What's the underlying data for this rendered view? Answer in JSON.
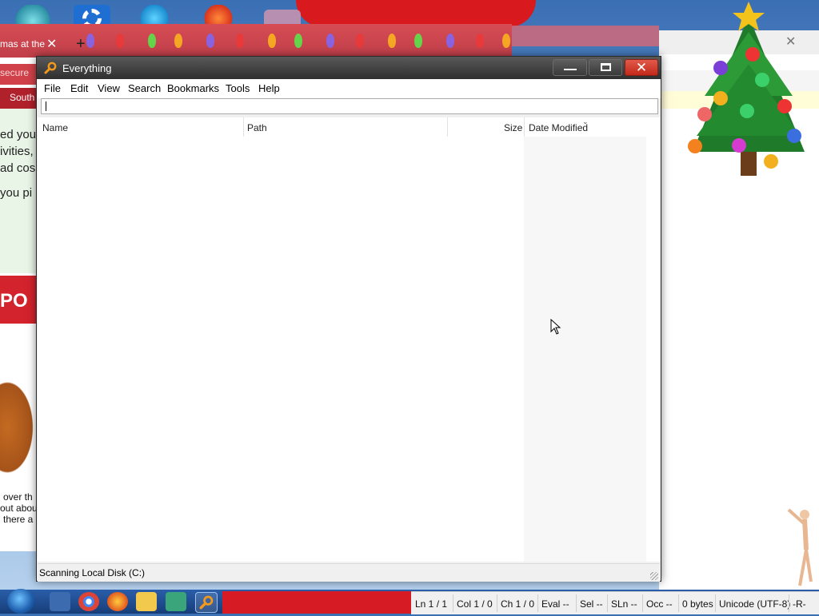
{
  "window": {
    "title": "Everything",
    "menu": [
      "File",
      "Edit",
      "View",
      "Search",
      "Bookmarks",
      "Tools",
      "Help"
    ],
    "search": {
      "value": "",
      "placeholder": ""
    },
    "columns": [
      "Name",
      "Path",
      "Size",
      "Date Modified"
    ],
    "status": "Scanning Local Disk (C:)"
  },
  "background_browser": {
    "tab_title": "mas at the",
    "address_fragment": "secure",
    "nav_fragment": "South",
    "content_lines": [
      "ed your",
      "ivities,",
      "ad cos",
      "you pi"
    ],
    "band_text": "PO",
    "lower_lines": [
      "over th",
      "out abou",
      "there a"
    ]
  },
  "editor_status": {
    "items": [
      "Ln 1 / 1",
      "Col 1 / 0",
      "Ch 1 / 0",
      "Eval --",
      "Sel --",
      "SLn --",
      "Occ --",
      "0 bytes",
      "Unicode (UTF-8)",
      "-R-"
    ]
  },
  "colors": {
    "titlebar": "#3a3a3a",
    "close_red": "#d2392a",
    "taskbar_blue": "#1f4d92",
    "browser_red": "#c8404a"
  },
  "icons": {
    "app": "magnifier-icon",
    "close": "close-icon",
    "minimize": "minimize-icon",
    "maximize": "maximize-icon"
  }
}
